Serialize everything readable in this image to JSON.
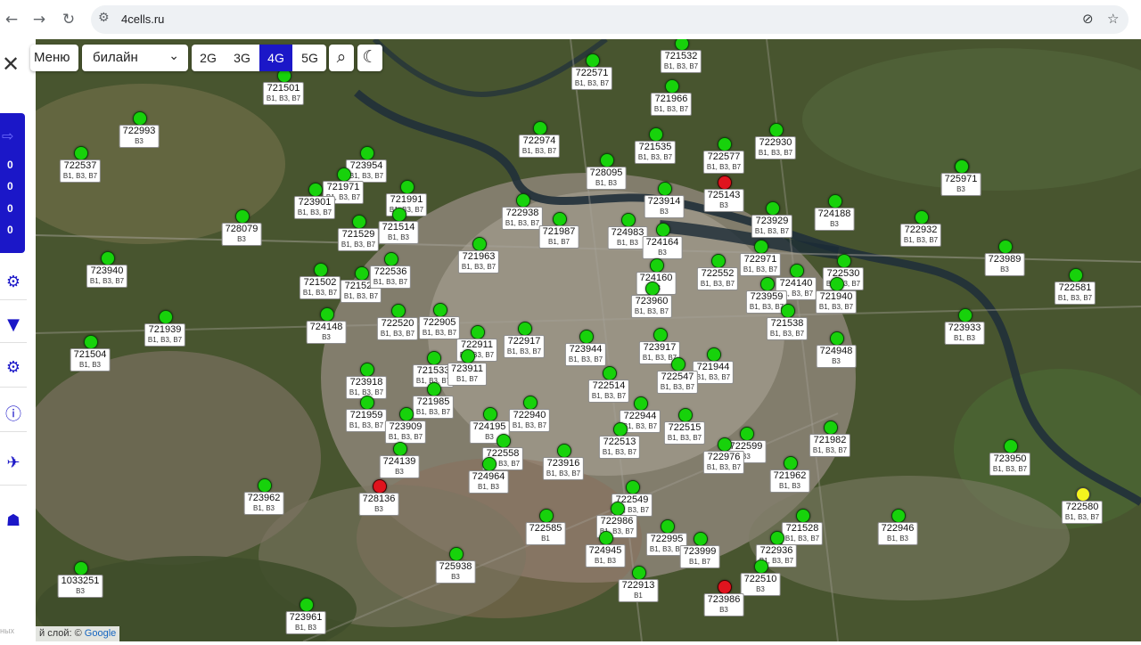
{
  "browser": {
    "back_icon": "arrow-left-icon",
    "forward_icon": "arrow-right-icon",
    "reload_icon": "reload-icon",
    "url": "4cells.ru"
  },
  "sidebar": {
    "counters": [
      "0",
      "0",
      "0",
      "0"
    ]
  },
  "toolbar": {
    "menu_label": "Меню",
    "operator": "билайн",
    "generations": [
      "2G",
      "3G",
      "4G",
      "5G"
    ],
    "active_generation": "4G"
  },
  "colors": {
    "accent": "#1b17c8",
    "marker_green": "#17d20b",
    "marker_red": "#e0141e",
    "marker_yellow": "#f4f41e"
  },
  "map_attribution": {
    "prefix": "й слой: ©",
    "provider": "Google",
    "left_text": "ных"
  },
  "towers": [
    {
      "id": "721532",
      "bands": "B1, B3, B7",
      "c": "g"
    },
    {
      "id": "721501",
      "bands": "B1, B3, B7",
      "c": "g"
    },
    {
      "id": "722571",
      "bands": "B1, B3, B7",
      "c": "g"
    },
    {
      "id": "721966",
      "bands": "B1, B3, B7",
      "c": "g"
    },
    {
      "id": "722993",
      "bands": "B3",
      "c": "g"
    },
    {
      "id": "722537",
      "bands": "B1, B3, B7",
      "c": "g"
    },
    {
      "id": "723954",
      "bands": "B1, B3, B7",
      "c": "g"
    },
    {
      "id": "721971",
      "bands": "B1, B3, B7",
      "c": "g"
    },
    {
      "id": "723901",
      "bands": "B1, B3, B7",
      "c": "g"
    },
    {
      "id": "721991",
      "bands": "B1, B3, B7",
      "c": "g"
    },
    {
      "id": "728079",
      "bands": "B3",
      "c": "g"
    },
    {
      "id": "721529",
      "bands": "B1, B3, B7",
      "c": "g"
    },
    {
      "id": "721514",
      "bands": "B1, B3",
      "c": "g"
    },
    {
      "id": "722974",
      "bands": "B1, B3, B7",
      "c": "g"
    },
    {
      "id": "722938",
      "bands": "B1, B3, B7",
      "c": "g"
    },
    {
      "id": "721987",
      "bands": "B1, B7",
      "c": "g"
    },
    {
      "id": "728095",
      "bands": "B1, B3",
      "c": "g"
    },
    {
      "id": "723914",
      "bands": "B3",
      "c": "g"
    },
    {
      "id": "724983",
      "bands": "B1, B3",
      "c": "g"
    },
    {
      "id": "724164",
      "bands": "B3",
      "c": "g"
    },
    {
      "id": "721535",
      "bands": "B1, B3, B7",
      "c": "g"
    },
    {
      "id": "722577",
      "bands": "B1, B3, B7",
      "c": "g"
    },
    {
      "id": "725143",
      "bands": "B3",
      "c": "r"
    },
    {
      "id": "722930",
      "bands": "B1, B3, B7",
      "c": "g"
    },
    {
      "id": "725971",
      "bands": "B3",
      "c": "g"
    },
    {
      "id": "723929",
      "bands": "B1, B3, B7",
      "c": "g"
    },
    {
      "id": "724188",
      "bands": "B3",
      "c": "g"
    },
    {
      "id": "722932",
      "bands": "B1, B3, B7",
      "c": "g"
    },
    {
      "id": "723989",
      "bands": "B3",
      "c": "g"
    },
    {
      "id": "722971",
      "bands": "B1, B3, B7",
      "c": "g"
    },
    {
      "id": "722530",
      "bands": "B1, B3, B7",
      "c": "g"
    },
    {
      "id": "722581",
      "bands": "B1, B3, B7",
      "c": "g"
    },
    {
      "id": "722552",
      "bands": "B1, B3, B7",
      "c": "g"
    },
    {
      "id": "724140",
      "bands": "B1, B3, B7",
      "c": "g"
    },
    {
      "id": "723959",
      "bands": "B1, B3, B7",
      "c": "g"
    },
    {
      "id": "721940",
      "bands": "B1, B3, B7",
      "c": "g"
    },
    {
      "id": "721538",
      "bands": "B1, B3, B7",
      "c": "g"
    },
    {
      "id": "723933",
      "bands": "B1, B3",
      "c": "g"
    },
    {
      "id": "724948",
      "bands": "B3",
      "c": "g"
    },
    {
      "id": "723940",
      "bands": "B1, B3, B7",
      "c": "g"
    },
    {
      "id": "721502",
      "bands": "B1, B3, B7",
      "c": "g"
    },
    {
      "id": "721523",
      "bands": "B1, B3, B7",
      "c": "g"
    },
    {
      "id": "722536",
      "bands": "B1, B3, B7",
      "c": "g"
    },
    {
      "id": "721963",
      "bands": "B1, B3, B7",
      "c": "g"
    },
    {
      "id": "724148",
      "bands": "B3",
      "c": "g"
    },
    {
      "id": "721939",
      "bands": "B1, B3, B7",
      "c": "g"
    },
    {
      "id": "722520",
      "bands": "B1, B3, B7",
      "c": "g"
    },
    {
      "id": "722905",
      "bands": "B1, B3, B7",
      "c": "g"
    },
    {
      "id": "722911",
      "bands": "B1, B3, B7",
      "c": "g"
    },
    {
      "id": "721504",
      "bands": "B1, B3",
      "c": "g"
    },
    {
      "id": "722917",
      "bands": "B1, B3, B7",
      "c": "g"
    },
    {
      "id": "723944",
      "bands": "B1, B3, B7",
      "c": "g"
    },
    {
      "id": "724160",
      "bands": "B3",
      "c": "g"
    },
    {
      "id": "723960",
      "bands": "B1, B3, B7",
      "c": "g"
    },
    {
      "id": "723917",
      "bands": "B1, B3, B7",
      "c": "g"
    },
    {
      "id": "721944",
      "bands": "B1, B3, B7",
      "c": "g"
    },
    {
      "id": "722547",
      "bands": "B1, B3, B7",
      "c": "g"
    },
    {
      "id": "721533",
      "bands": "B1, B3, B7",
      "c": "g"
    },
    {
      "id": "723911",
      "bands": "B1, B7",
      "c": "g"
    },
    {
      "id": "723918",
      "bands": "B1, B3, B7",
      "c": "g"
    },
    {
      "id": "721985",
      "bands": "B1, B3, B7",
      "c": "g"
    },
    {
      "id": "722514",
      "bands": "B1, B3, B7",
      "c": "g"
    },
    {
      "id": "721959",
      "bands": "B1, B3, B7",
      "c": "g"
    },
    {
      "id": "723909",
      "bands": "B1, B3, B7",
      "c": "g"
    },
    {
      "id": "722940",
      "bands": "B1, B3, B7",
      "c": "g"
    },
    {
      "id": "722944",
      "bands": "B1, B3, B7",
      "c": "g"
    },
    {
      "id": "722515",
      "bands": "B1, B3, B7",
      "c": "g"
    },
    {
      "id": "721982",
      "bands": "B1, B3, B7",
      "c": "g"
    },
    {
      "id": "725971",
      "bands": "B3",
      "c": "g"
    },
    {
      "id": "724195",
      "bands": "B3",
      "c": "g"
    },
    {
      "id": "722558",
      "bands": "B1, B3, B7",
      "c": "g"
    },
    {
      "id": "722513",
      "bands": "B1, B3, B7",
      "c": "g"
    },
    {
      "id": "722599",
      "bands": "B3",
      "c": "g"
    },
    {
      "id": "722976",
      "bands": "B1, B3, B7",
      "c": "g"
    },
    {
      "id": "724139",
      "bands": "B3",
      "c": "g"
    },
    {
      "id": "723916",
      "bands": "B1, B3, B7",
      "c": "g"
    },
    {
      "id": "723950",
      "bands": "B1, B3, B7",
      "c": "g"
    },
    {
      "id": "724964",
      "bands": "B1, B3",
      "c": "g"
    },
    {
      "id": "721962",
      "bands": "B1, B3",
      "c": "g"
    },
    {
      "id": "723962",
      "bands": "B1, B3",
      "c": "g"
    },
    {
      "id": "728136",
      "bands": "B3",
      "c": "r"
    },
    {
      "id": "722580",
      "bands": "B1, B3, B7",
      "c": "y"
    },
    {
      "id": "722549",
      "bands": "B1, B3, B7",
      "c": "g"
    },
    {
      "id": "722585",
      "bands": "B1",
      "c": "g"
    },
    {
      "id": "722986",
      "bands": "B1, B3, B7",
      "c": "g"
    },
    {
      "id": "721528",
      "bands": "B1, B3, B7",
      "c": "g"
    },
    {
      "id": "722946",
      "bands": "B1, B3",
      "c": "g"
    },
    {
      "id": "722995",
      "bands": "B1, B3, B7",
      "c": "g"
    },
    {
      "id": "722936",
      "bands": "B1, B3, B7",
      "c": "g"
    },
    {
      "id": "724945",
      "bands": "B1, B3",
      "c": "g"
    },
    {
      "id": "723999",
      "bands": "B1, B7",
      "c": "g"
    },
    {
      "id": "725938",
      "bands": "B3",
      "c": "g"
    },
    {
      "id": "722510",
      "bands": "B3",
      "c": "g"
    },
    {
      "id": "722913",
      "bands": "B1",
      "c": "g"
    },
    {
      "id": "723986",
      "bands": "B3",
      "c": "r"
    },
    {
      "id": "1033251",
      "bands": "B3",
      "c": "g"
    },
    {
      "id": "723961",
      "bands": "B1, B3",
      "c": "g"
    }
  ]
}
